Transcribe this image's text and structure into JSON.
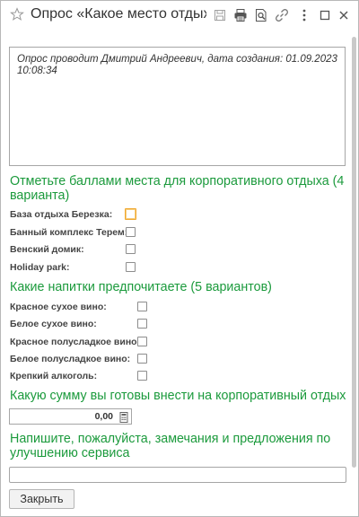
{
  "window": {
    "title": "Опрос «Какое место отдых…"
  },
  "memo": {
    "text": "Опрос проводит Дмитрий Андреевич, дата создания: 01.09.2023 10:08:34"
  },
  "places": {
    "heading": "Отметьте баллами места для корпоративного отдыха (4 варианта)",
    "items": [
      {
        "label": "База отдыха Березка:"
      },
      {
        "label": "Банный комплекс Терем:"
      },
      {
        "label": "Венский домик:"
      },
      {
        "label": "Holiday park:"
      }
    ]
  },
  "drinks": {
    "heading": "Какие напитки предпочитаете (5 вариантов)",
    "items": [
      {
        "label": "Красное сухое вино:"
      },
      {
        "label": "Белое сухое вино:"
      },
      {
        "label": "Красное полусладкое вино:"
      },
      {
        "label": "Белое полусладкое вино:"
      },
      {
        "label": "Крепкий алкоголь:"
      }
    ]
  },
  "amount": {
    "heading": "Какую сумму вы готовы внести на корпоративный отдых",
    "value": "0,00"
  },
  "feedback": {
    "heading": "Напишите, пожалуйста, замечания и предложения по улучшению сервиса",
    "value": ""
  },
  "buttons": {
    "close": "Закрыть"
  },
  "icons": {
    "favorite": "star-icon",
    "save": "save-icon",
    "print": "print-icon",
    "preview": "preview-icon",
    "link": "link-icon",
    "more": "more-icon",
    "restore": "restore-icon",
    "close": "close-icon",
    "calculator": "calculator-icon"
  },
  "colors": {
    "heading": "#1b9a3c",
    "focus": "#f0a830"
  }
}
